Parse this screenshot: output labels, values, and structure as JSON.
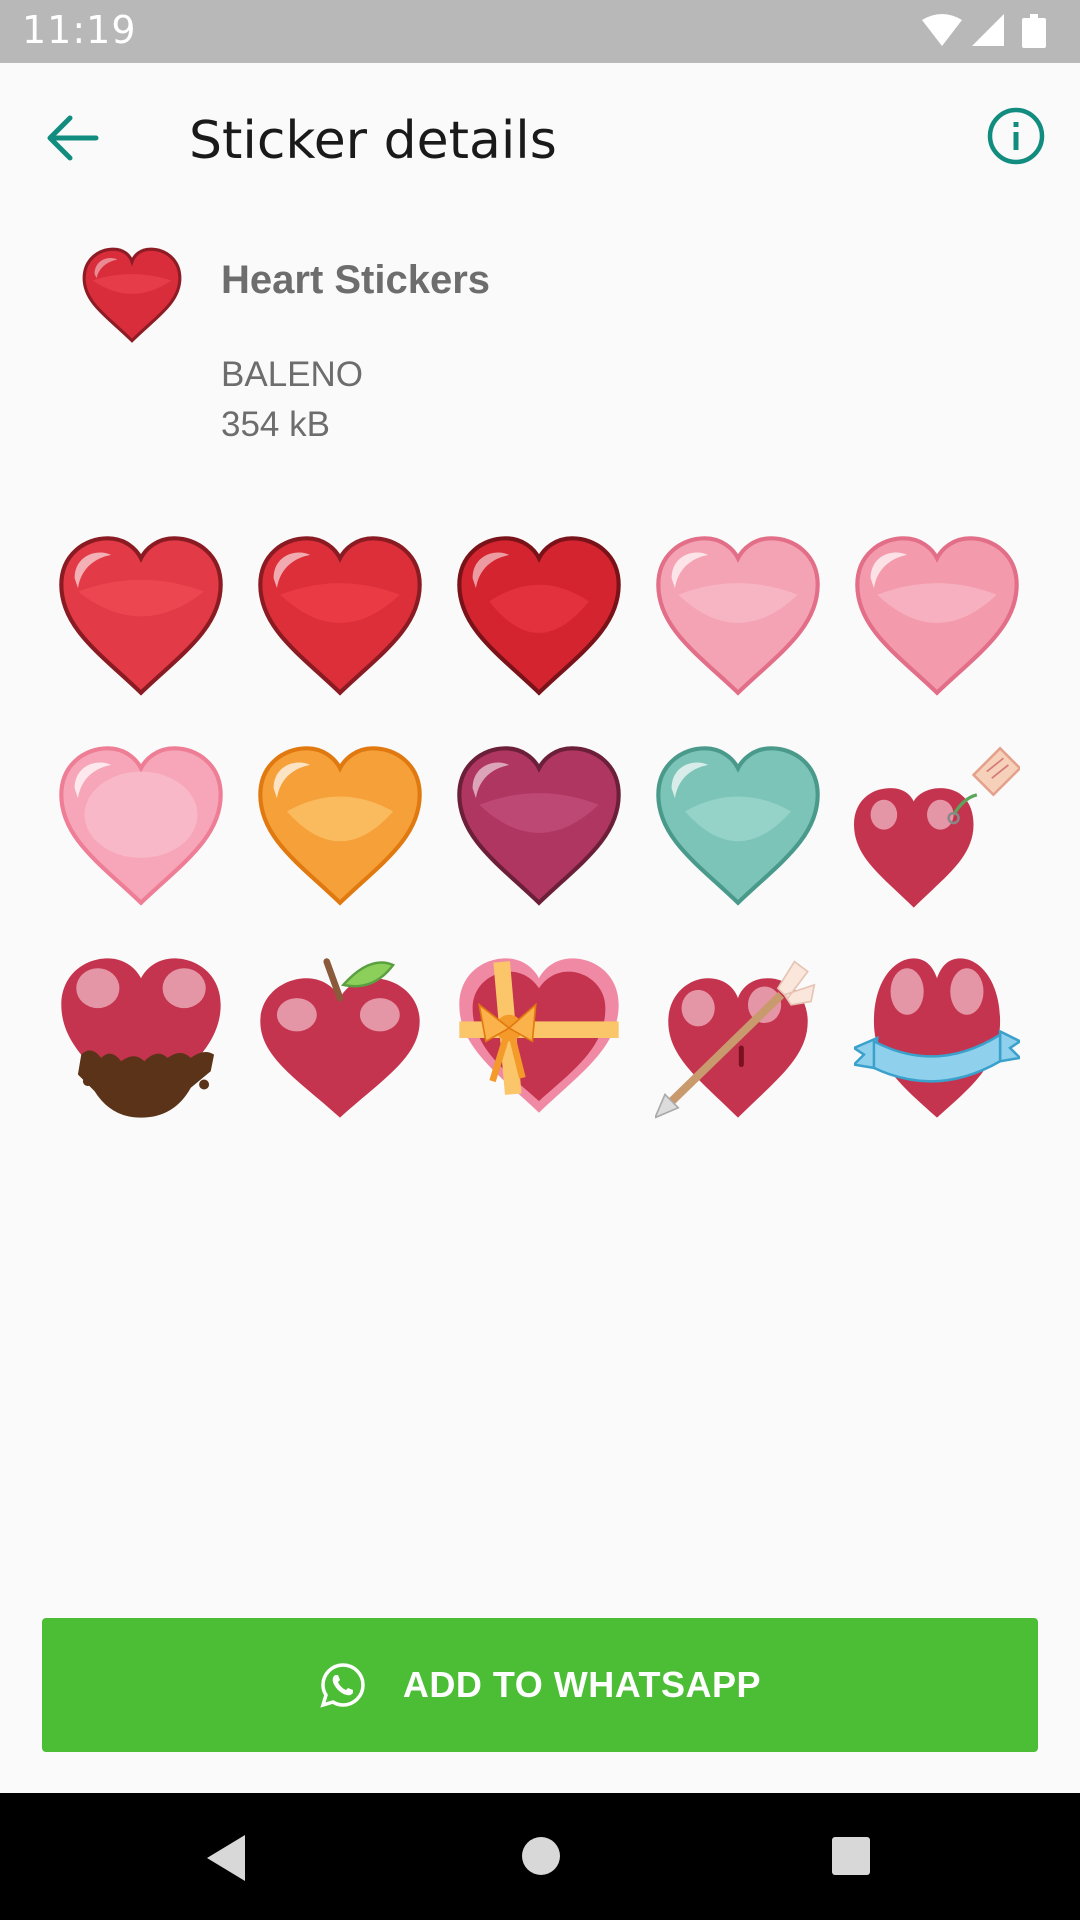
{
  "status_bar": {
    "time": "11:19",
    "icons": [
      "wifi-icon",
      "signal-icon",
      "battery-icon"
    ]
  },
  "toolbar": {
    "title": "Sticker details",
    "back_icon": "arrow-left-icon",
    "info_icon": "info-icon"
  },
  "pack": {
    "name": "Heart Stickers",
    "publisher": "BALENO",
    "size": "354 kB",
    "tray_icon": "red-heart"
  },
  "stickers": [
    {
      "kind": "red-heart"
    },
    {
      "kind": "red-heart"
    },
    {
      "kind": "red-heart"
    },
    {
      "kind": "pink-heart"
    },
    {
      "kind": "pink-heart"
    },
    {
      "kind": "light-pink-heart"
    },
    {
      "kind": "orange-heart"
    },
    {
      "kind": "plum-heart"
    },
    {
      "kind": "teal-heart"
    },
    {
      "kind": "heart-with-tag"
    },
    {
      "kind": "chocolate-dipped-heart"
    },
    {
      "kind": "apple-heart"
    },
    {
      "kind": "gift-box-heart"
    },
    {
      "kind": "arrow-pierced-heart"
    },
    {
      "kind": "ribbon-heart"
    }
  ],
  "colors": {
    "accent": "#128c7e",
    "button": "#4cbe36",
    "status_bar": "#b8b8b8"
  },
  "add_button": {
    "label": "ADD TO WHATSAPP",
    "icon": "whatsapp-icon"
  },
  "nav_bar": {
    "icons": [
      "nav-back-icon",
      "nav-home-icon",
      "nav-recents-icon"
    ]
  }
}
